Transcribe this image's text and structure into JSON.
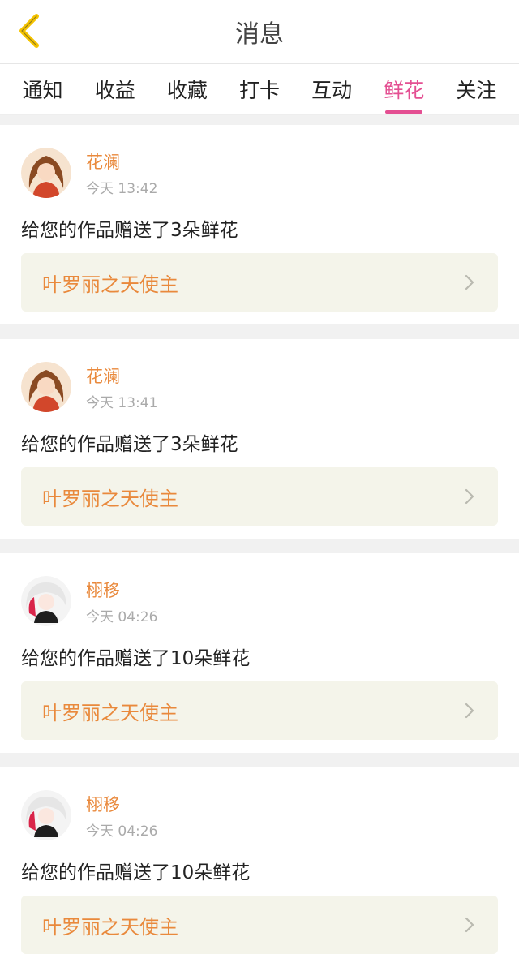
{
  "header": {
    "title": "消息",
    "back_icon": "chevron-left-icon",
    "accent": "#f5c400"
  },
  "tabs": [
    {
      "label": "通知"
    },
    {
      "label": "收益"
    },
    {
      "label": "收藏"
    },
    {
      "label": "打卡"
    },
    {
      "label": "互动"
    },
    {
      "label": "鲜花",
      "active": true
    },
    {
      "label": "关注"
    }
  ],
  "colors": {
    "active_tab": "#e44f92",
    "username": "#e9893c",
    "work_bg": "#f4f4ea"
  },
  "messages": [
    {
      "user": "花澜",
      "time": "今天 13:42",
      "text": "给您的作品赠送了3朵鲜花",
      "work": "叶罗丽之天使主"
    },
    {
      "user": "花澜",
      "time": "今天 13:41",
      "text": "给您的作品赠送了3朵鲜花",
      "work": "叶罗丽之天使主"
    },
    {
      "user": "栩移",
      "time": "今天 04:26",
      "text": "给您的作品赠送了10朵鲜花",
      "work": "叶罗丽之天使主"
    },
    {
      "user": "栩移",
      "time": "今天 04:26",
      "text": "给您的作品赠送了10朵鲜花",
      "work": "叶罗丽之天使主"
    }
  ]
}
